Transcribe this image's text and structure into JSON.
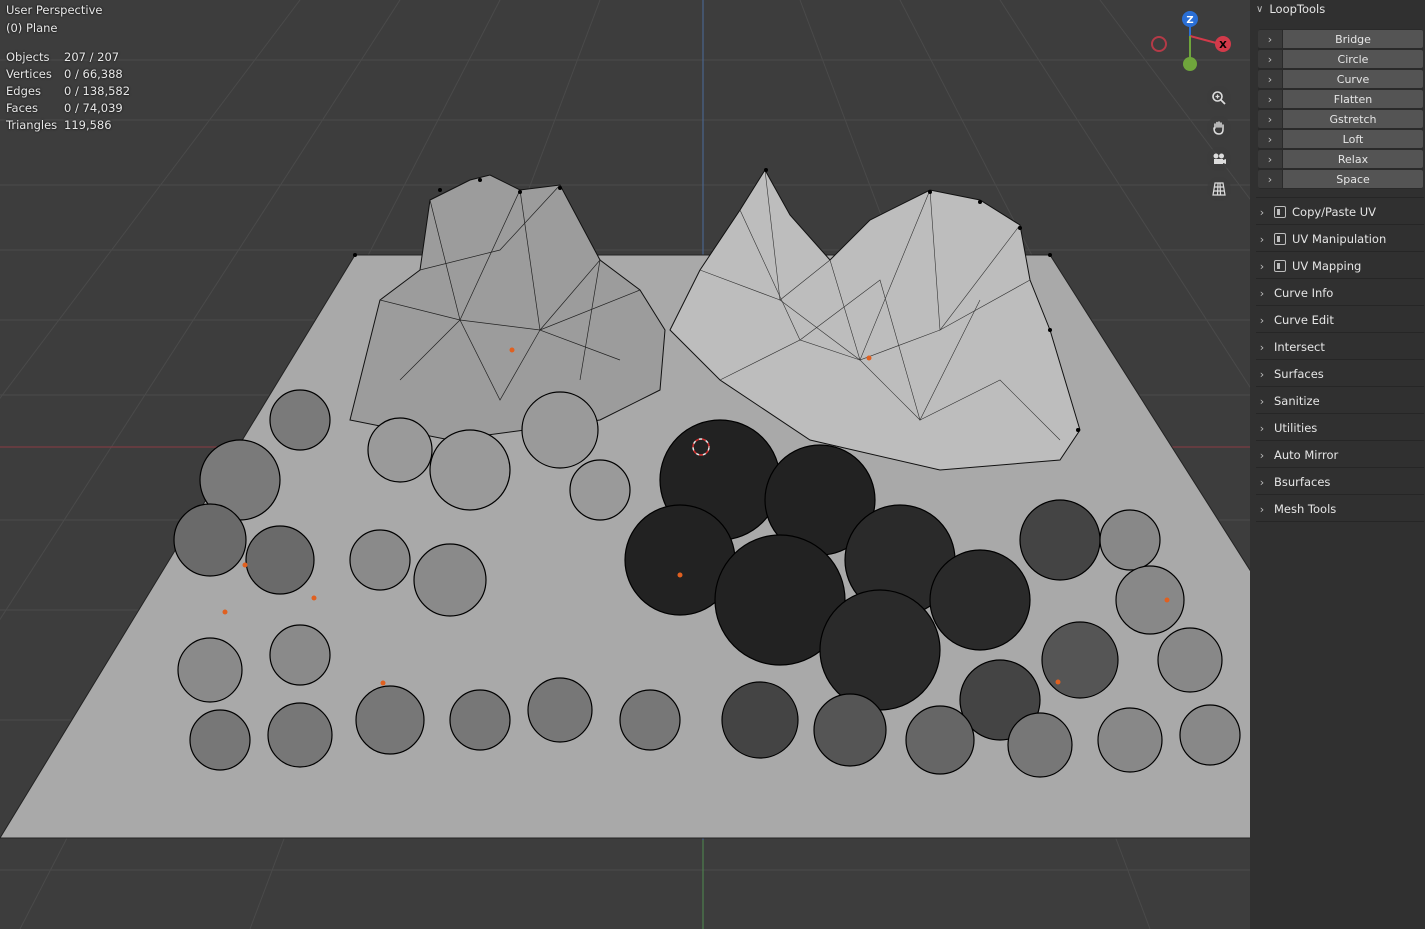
{
  "viewport": {
    "title": "User Perspective",
    "subtitle": "(0) Plane",
    "stats": [
      {
        "label": "Objects",
        "value": "207 / 207"
      },
      {
        "label": "Vertices",
        "value": "0 / 66,388"
      },
      {
        "label": "Edges",
        "value": "0 / 138,582"
      },
      {
        "label": "Faces",
        "value": "0 / 74,039"
      },
      {
        "label": "Triangles",
        "value": "119,586"
      }
    ],
    "gizmo": {
      "z_label": "Z",
      "x_label": "X",
      "z_color": "#2a6fd6",
      "x_color": "#d23a4a",
      "y_color": "#6fa53c"
    },
    "nav_icons": [
      "zoom-icon",
      "hand-pan-icon",
      "camera-icon",
      "grid-ortho-icon"
    ]
  },
  "sidebar": {
    "looptools": {
      "title": "LoopTools",
      "buttons": [
        "Bridge",
        "Circle",
        "Curve",
        "Flatten",
        "Gstretch",
        "Loft",
        "Relax",
        "Space"
      ]
    },
    "panels": [
      {
        "label": "Copy/Paste UV",
        "icon": true
      },
      {
        "label": "UV Manipulation",
        "icon": true
      },
      {
        "label": "UV Mapping",
        "icon": true
      },
      {
        "label": "Curve Info",
        "icon": false
      },
      {
        "label": "Curve Edit",
        "icon": false
      },
      {
        "label": "Intersect",
        "icon": false
      },
      {
        "label": "Surfaces",
        "icon": false
      },
      {
        "label": "Sanitize",
        "icon": false
      },
      {
        "label": "Utilities",
        "icon": false
      },
      {
        "label": "Auto Mirror",
        "icon": false
      },
      {
        "label": "Bsurfaces",
        "icon": false
      },
      {
        "label": "Mesh Tools",
        "icon": false
      }
    ]
  }
}
